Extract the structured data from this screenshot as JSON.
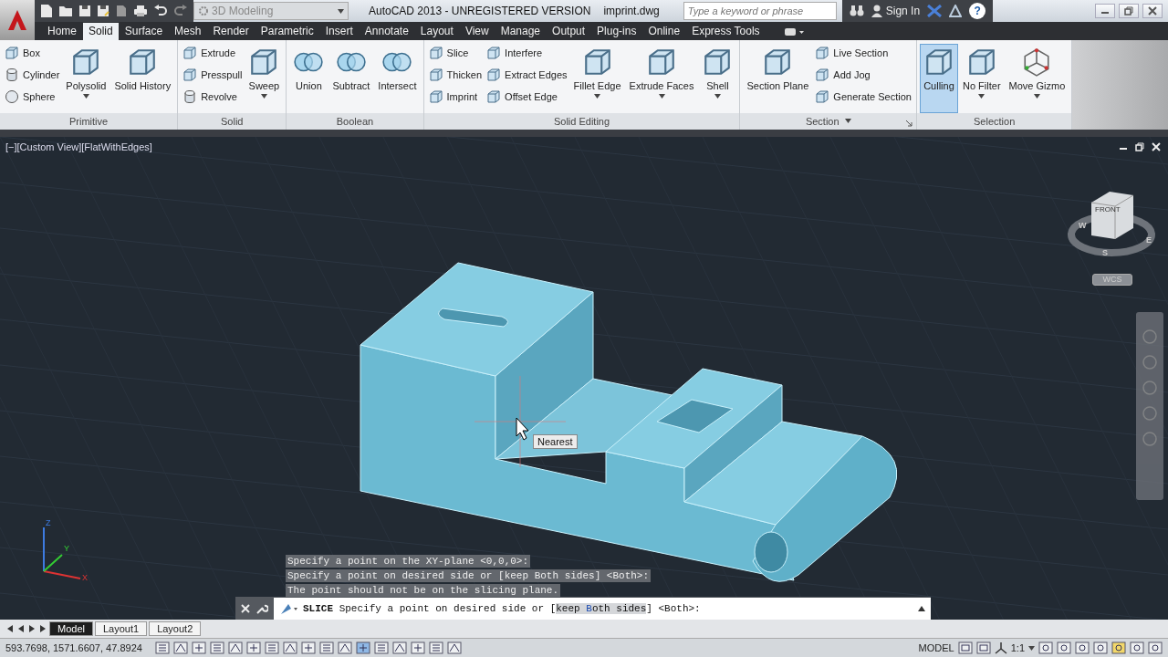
{
  "title_bar": {
    "workspace": "3D Modeling",
    "title": "AutoCAD 2013 - UNREGISTERED VERSION",
    "file": "imprint.dwg",
    "search": {
      "placeholder": "Type a keyword or phrase"
    },
    "sign_in": "Sign In",
    "help": "?"
  },
  "ribbon_tabs": [
    {
      "label": "Home",
      "selected": false
    },
    {
      "label": "Solid",
      "selected": true
    },
    {
      "label": "Surface",
      "selected": false
    },
    {
      "label": "Mesh",
      "selected": false
    },
    {
      "label": "Render",
      "selected": false
    },
    {
      "label": "Parametric",
      "selected": false
    },
    {
      "label": "Insert",
      "selected": false
    },
    {
      "label": "Annotate",
      "selected": false
    },
    {
      "label": "Layout",
      "selected": false
    },
    {
      "label": "View",
      "selected": false
    },
    {
      "label": "Manage",
      "selected": false
    },
    {
      "label": "Output",
      "selected": false
    },
    {
      "label": "Plug-ins",
      "selected": false
    },
    {
      "label": "Online",
      "selected": false
    },
    {
      "label": "Express Tools",
      "selected": false
    }
  ],
  "ribbon_panels": [
    {
      "title": "Primitive",
      "menu": false,
      "launcher": false,
      "items": [
        {
          "kind": "stack",
          "tools": [
            {
              "label": "Box"
            },
            {
              "label": "Cylinder"
            },
            {
              "label": "Sphere"
            }
          ]
        },
        {
          "kind": "large",
          "label": "Polysolid",
          "dropdown": true
        },
        {
          "kind": "large",
          "label": "Solid History",
          "dropdown": false
        }
      ]
    },
    {
      "title": "Solid",
      "menu": false,
      "launcher": false,
      "items": [
        {
          "kind": "stack",
          "tools": [
            {
              "label": "Extrude"
            },
            {
              "label": "Presspull"
            },
            {
              "label": "Revolve"
            }
          ]
        },
        {
          "kind": "large",
          "label": "Sweep",
          "dropdown": true
        }
      ]
    },
    {
      "title": "Boolean",
      "menu": false,
      "launcher": false,
      "items": [
        {
          "kind": "large",
          "label": "Union",
          "dropdown": false
        },
        {
          "kind": "large",
          "label": "Subtract",
          "dropdown": false
        },
        {
          "kind": "large",
          "label": "Intersect",
          "dropdown": false
        }
      ]
    },
    {
      "title": "Solid Editing",
      "menu": false,
      "launcher": false,
      "items": [
        {
          "kind": "stack",
          "tools": [
            {
              "label": "Slice"
            },
            {
              "label": "Thicken"
            },
            {
              "label": "Imprint"
            }
          ]
        },
        {
          "kind": "stack",
          "tools": [
            {
              "label": "Interfere"
            },
            {
              "label": "Extract Edges"
            },
            {
              "label": "Offset Edge"
            }
          ]
        },
        {
          "kind": "large",
          "label": "Fillet Edge",
          "dropdown": true
        },
        {
          "kind": "large",
          "label": "Extrude Faces",
          "dropdown": true
        },
        {
          "kind": "large",
          "label": "Shell",
          "dropdown": true
        }
      ]
    },
    {
      "title": "Section",
      "menu": true,
      "launcher": true,
      "items": [
        {
          "kind": "large",
          "label": "Section Plane",
          "dropdown": false
        },
        {
          "kind": "stack",
          "tools": [
            {
              "label": "Live Section"
            },
            {
              "label": "Add Jog"
            },
            {
              "label": "Generate Section"
            }
          ]
        }
      ]
    },
    {
      "title": "Selection",
      "menu": false,
      "launcher": false,
      "items": [
        {
          "kind": "large",
          "label": "Culling",
          "dropdown": false,
          "on": true
        },
        {
          "kind": "large",
          "label": "No Filter",
          "dropdown": true,
          "on": false
        },
        {
          "kind": "large",
          "label": "Move Gizmo",
          "dropdown": true,
          "on": false
        }
      ]
    }
  ],
  "viewport": {
    "label": "[−][Custom View][FlatWithEdges]",
    "tooltip": "Nearest",
    "viewcube": {
      "face": "FRONT",
      "compass": [
        "W",
        "S",
        "E"
      ],
      "ucs_button": "WCS"
    },
    "ucs_axes": [
      "Z",
      "Y",
      "X"
    ]
  },
  "command_history": [
    "Specify a point on the XY-plane <0,0,0>:",
    "Specify a point on desired side or [keep Both sides] <Both>:",
    "The point should not be on the slicing plane."
  ],
  "command_line": {
    "command": "SLICE",
    "prompt": "Specify a point on desired side or [",
    "option": {
      "before": "keep ",
      "key": "B",
      "after": "oth sides"
    },
    "after": "] <Both>:"
  },
  "layout_tabs": [
    {
      "label": "Model",
      "selected": true
    },
    {
      "label": "Layout1",
      "selected": false
    },
    {
      "label": "Layout2",
      "selected": false
    }
  ],
  "status_bar": {
    "coordinates": "593.7698, 1571.6607, 47.8924",
    "space": "MODEL",
    "scale": "1:1"
  }
}
